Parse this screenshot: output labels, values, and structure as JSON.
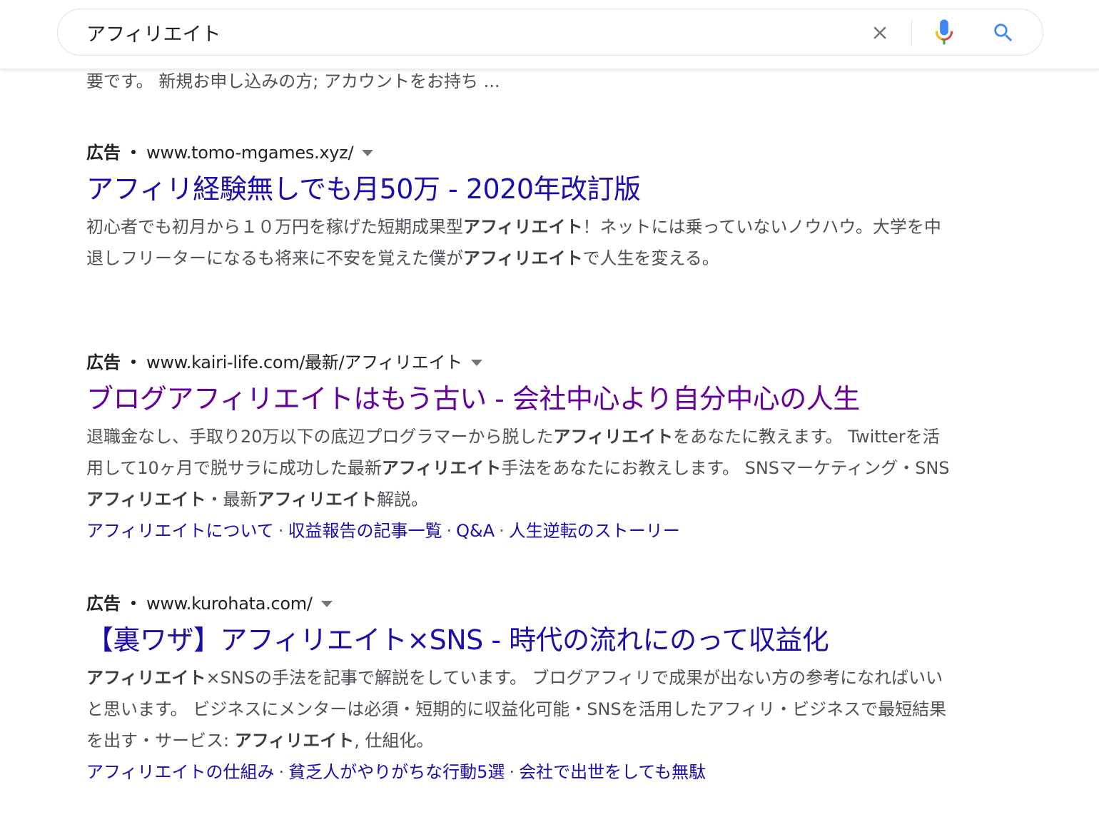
{
  "search": {
    "query": "アフィリエイト",
    "clear_icon": "close-icon",
    "mic_icon": "microphone-icon",
    "search_icon": "search-icon"
  },
  "colors": {
    "link": "#1a0dab",
    "visited": "#660099",
    "snippet": "#4d5156",
    "url": "#202124"
  },
  "previous_snippet_tail": "要です。 新規お申し込みの方; アカウントをお持ち ...",
  "results": [
    {
      "ad_label": "広告",
      "dot": "・",
      "url": "www.tomo-mgames.xyz/",
      "title": "アフィリ経験無しでも月50万 - 2020年改訂版",
      "description": [
        {
          "text": "初心者でも初月から１０万円を稼げた短期成果型",
          "bold": false
        },
        {
          "text": "アフィリエイト",
          "bold": true
        },
        {
          "text": "！ネットには乗っていないノウハウ。大学を中退しフリーターになるも将来に不安を覚えた僕が",
          "bold": false
        },
        {
          "text": "アフィリエイト",
          "bold": true
        },
        {
          "text": "で人生を変える。",
          "bold": false
        }
      ],
      "sitelinks": []
    },
    {
      "ad_label": "広告",
      "dot": "・",
      "url": "www.kairi-life.com/最新/アフィリエイト",
      "title": "ブログアフィリエイトはもう古い - 会社中心より自分中心の人生",
      "visited": true,
      "description": [
        {
          "text": "退職金なし、手取り20万以下の底辺プログラマーから脱した",
          "bold": false
        },
        {
          "text": "アフィリエイト",
          "bold": true
        },
        {
          "text": "をあなたに教えます。 Twitterを活用して10ヶ月で脱サラに成功した最新",
          "bold": false
        },
        {
          "text": "アフィリエイト",
          "bold": true
        },
        {
          "text": "手法をあなたにお教えします。 SNSマーケティング・SNS",
          "bold": false
        },
        {
          "text": "アフィリエイト",
          "bold": true
        },
        {
          "text": "・最新",
          "bold": false
        },
        {
          "text": "アフィリエイト",
          "bold": true
        },
        {
          "text": "解説。",
          "bold": false
        }
      ],
      "sitelinks": [
        "アフィリエイトについて",
        "収益報告の記事一覧",
        "Q&A",
        "人生逆転のストーリー"
      ]
    },
    {
      "ad_label": "広告",
      "dot": "・",
      "url": "www.kurohata.com/",
      "title": "【裏ワザ】アフィリエイト×SNS - 時代の流れにのって収益化",
      "description": [
        {
          "text": "アフィリエイト",
          "bold": true
        },
        {
          "text": "×SNSの手法を記事で解説をしています。 ブログアフィリで成果が出ない方の参考になればいいと思います。 ビジネスにメンターは必須・短期的に収益化可能・SNSを活用したアフィリ・ビジネスで最短結果を出す・サービス: ",
          "bold": false
        },
        {
          "text": "アフィリエイト",
          "bold": true
        },
        {
          "text": ", 仕組化。",
          "bold": false
        }
      ],
      "sitelinks": [
        "アフィリエイトの仕組み",
        "貧乏人がやりがちな行動5選",
        "会社で出世をしても無駄"
      ]
    }
  ],
  "sitelink_separator": "·"
}
